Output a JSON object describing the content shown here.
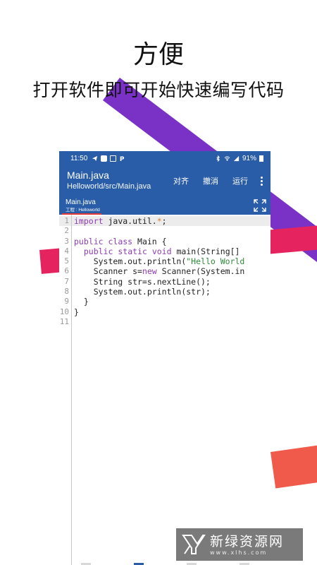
{
  "promo": {
    "title": "方便",
    "subtitle": "打开软件即可开始快速编写代码"
  },
  "statusbar": {
    "time": "11:50",
    "battery": "91%"
  },
  "toolbar": {
    "title": "Main.java",
    "subtitle": "Helloworld/src/Main.java",
    "actions": [
      "对齐",
      "撤消",
      "运行"
    ]
  },
  "tab": {
    "name": "Main.java",
    "project": "工程 : Helloworld"
  },
  "editor": {
    "current_line": 1,
    "lines": [
      {
        "n": "1"
      },
      {
        "n": "2"
      },
      {
        "n": "3"
      },
      {
        "n": "4"
      },
      {
        "n": "5"
      },
      {
        "n": "6"
      },
      {
        "n": "7"
      },
      {
        "n": "8"
      },
      {
        "n": "9"
      },
      {
        "n": "10"
      },
      {
        "n": "11"
      }
    ]
  },
  "colors": {
    "primary": "#2a5da8",
    "tab_indicator": "#e53935",
    "keyword": "#8e3bb0",
    "string": "#2e8b3a",
    "stripe_purple": "#7a32c6",
    "stripe_red": "#e5245f",
    "stripe_orange": "#ef5a4a"
  },
  "watermark": {
    "name": "新绿资源网",
    "url": "www.xlhs.com"
  }
}
